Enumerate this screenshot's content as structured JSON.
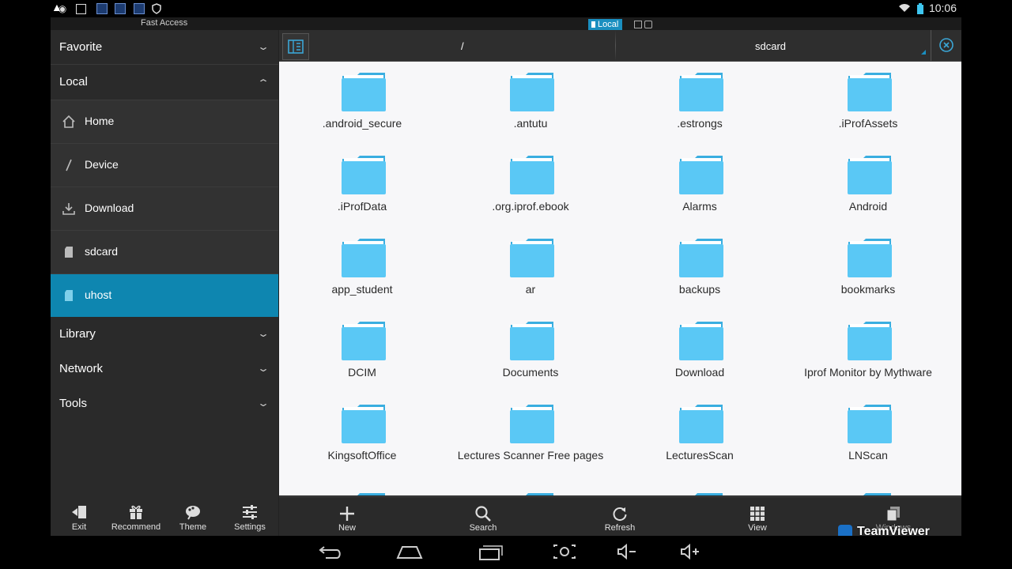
{
  "status_bar": {
    "time": "10:06"
  },
  "fast_access": {
    "title": "Fast Access",
    "local_chip": "Local"
  },
  "sidebar": {
    "sections": [
      {
        "label": "Favorite"
      },
      {
        "label": "Local"
      },
      {
        "label": "Library"
      },
      {
        "label": "Network"
      },
      {
        "label": "Tools"
      }
    ],
    "local_items": [
      {
        "label": "Home",
        "icon": "home-icon"
      },
      {
        "label": "Device",
        "icon": "slash-icon"
      },
      {
        "label": "Download",
        "icon": "download-icon"
      },
      {
        "label": "sdcard",
        "icon": "sdcard-icon"
      },
      {
        "label": "uhost",
        "icon": "sdcard-icon",
        "selected": true
      }
    ],
    "bottom_tools": [
      {
        "label": "Exit",
        "icon": "exit-icon"
      },
      {
        "label": "Recommend",
        "icon": "gift-icon"
      },
      {
        "label": "Theme",
        "icon": "theme-icon"
      },
      {
        "label": "Settings",
        "icon": "settings-icon"
      }
    ]
  },
  "path_bar": {
    "root": "/",
    "current": "sdcard"
  },
  "folders": [
    ".android_secure",
    ".antutu",
    ".estrongs",
    ".iProfAssets",
    ".iProfData",
    ".org.iprof.ebook",
    "Alarms",
    "Android",
    "app_student",
    "ar",
    "backups",
    "bookmarks",
    "DCIM",
    "Documents",
    "Download",
    "Iprof Monitor by Mythware",
    "KingsoftOffice",
    "Lectures Scanner Free pages",
    "LecturesScan",
    "LNScan"
  ],
  "toolbar": {
    "new_label": "New",
    "search_label": "Search",
    "refresh_label": "Refresh",
    "view_label": "View",
    "windows_label": "Windows"
  },
  "overlay": {
    "teamviewer": "TeamViewer"
  },
  "colors": {
    "accent": "#0e86b0",
    "folder": "#5ac8f5"
  }
}
